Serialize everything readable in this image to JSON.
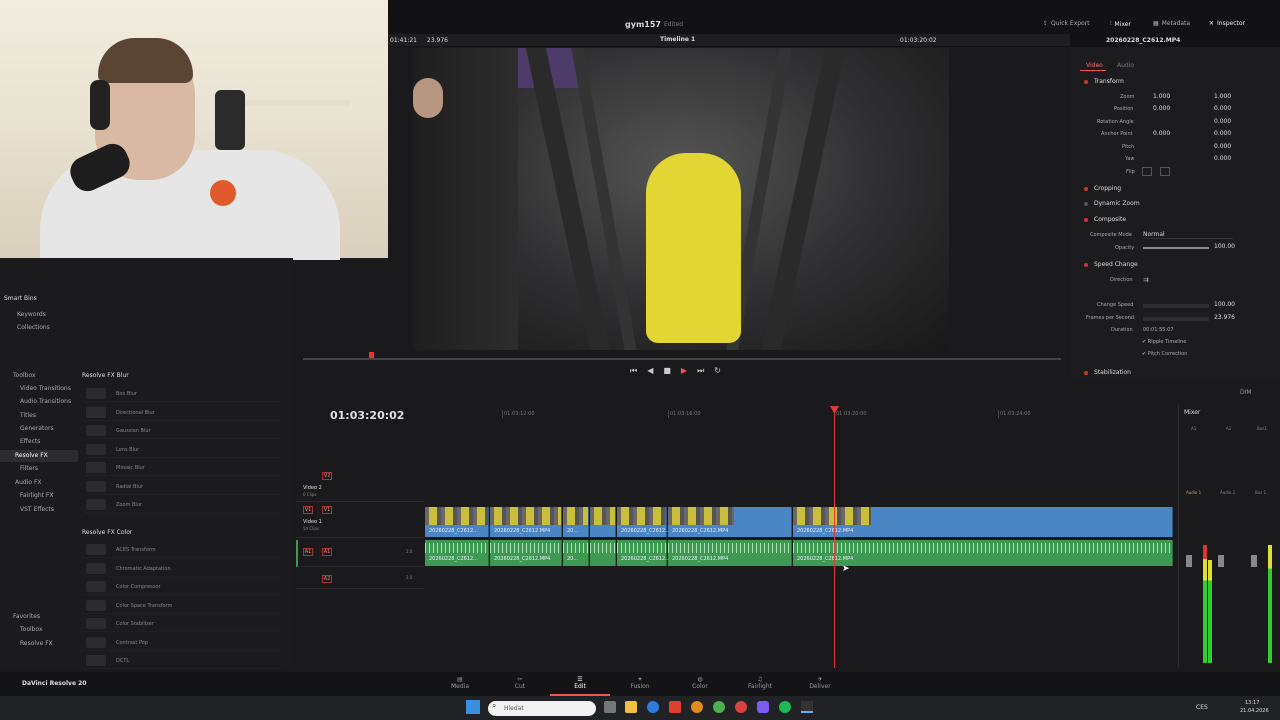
{
  "app": {
    "project": "gym157",
    "edited": "Edited",
    "name": "DaVinci Resolve 20"
  },
  "topbar": {
    "quick_export": "Quick Export",
    "mixer": "Mixer",
    "metadata": "Metadata",
    "inspector": "Inspector"
  },
  "viewer": {
    "tc_left": "01:41:21",
    "fps": "23.976",
    "timeline_name": "Timeline 1",
    "tc_right": "01:03:20:02"
  },
  "inspector": {
    "clip_name": "20260228_C2612.MP4",
    "tabs": [
      "Video",
      "Audio"
    ],
    "transform": "Transform",
    "rows": [
      {
        "label": "Zoom",
        "x": "1.000",
        "y": "1.000"
      },
      {
        "label": "Position",
        "x": "0.000",
        "y": "0.000"
      },
      {
        "label": "Rotation Angle",
        "y": "0.000"
      },
      {
        "label": "Anchor Point",
        "x": "0.000",
        "y": "0.000"
      },
      {
        "label": "Pitch",
        "y": "0.000"
      },
      {
        "label": "Yaw",
        "y": "0.000"
      },
      {
        "label": "Flip"
      }
    ],
    "cropping": "Cropping",
    "dynamic_zoom": "Dynamic Zoom",
    "composite": "Composite",
    "composite_mode_label": "Composite Mode",
    "composite_mode": "Normal",
    "opacity_label": "Opacity",
    "opacity": "100.00",
    "speed_change": "Speed Change",
    "direction": "Direction",
    "change_speed_label": "Change Speed",
    "change_speed": "100.00",
    "fps_label": "Frames per Second",
    "fps": "23.976",
    "duration_label": "Duration",
    "duration": "00:01:55:07",
    "ripple": "Ripple Timeline",
    "pitch_corr": "Pitch Correction",
    "stabilization": "Stabilization"
  },
  "left": {
    "smart_bins": "Smart Bins",
    "keywords": "Keywords",
    "collections": "Collections",
    "toolbox": "Toolbox",
    "tree": [
      "Video Transitions",
      "Audio Transitions",
      "Titles",
      "Generators",
      "Effects",
      "Resolve FX",
      "Filters",
      "Audio FX",
      "Fairlight FX",
      "VST Effects"
    ],
    "favorites": "Favorites",
    "fav_items": [
      "Toolbox",
      "Resolve FX"
    ],
    "blur_header": "Resolve FX Blur",
    "blur": [
      "Box Blur",
      "Directional Blur",
      "Gaussian Blur",
      "Lens Blur",
      "Mosaic Blur",
      "Radial Blur",
      "Zoom Blur"
    ],
    "color_header": "Resolve FX Color",
    "color": [
      "ACES Transform",
      "Chromatic Adaptation",
      "Color Compressor",
      "Color Space Transform",
      "Color Stabilizer",
      "Contrast Pop",
      "DCTL"
    ]
  },
  "timeline": {
    "timecode": "01:03:20:02",
    "ruler": [
      "01:03:12:00",
      "01:03:16:00",
      "01:03:20:00",
      "01:03:24:00"
    ],
    "tracks": {
      "v2": {
        "id": "V2",
        "name": "Video 2",
        "sub": "0 Clips"
      },
      "v1": {
        "id": "V1",
        "name": "Video 1",
        "sub": "54 Clips"
      },
      "a1": {
        "id": "A1",
        "ch": "2.0"
      },
      "a2": {
        "id": "A2",
        "ch": "2.0"
      }
    },
    "clip": "20260228_C2612.MP4",
    "clip_short": "20260228_C2612...",
    "clip_tiny": "20..."
  },
  "mixer": {
    "title": "Mixer",
    "channels": [
      "A1",
      "A2",
      "Bus1"
    ],
    "meters": [
      "Audio 1",
      "Audio 2",
      "Bus 1"
    ],
    "dim": "DIM"
  },
  "pages": [
    "Media",
    "Cut",
    "Edit",
    "Fusion",
    "Color",
    "Fairlight",
    "Deliver"
  ],
  "taskbar": {
    "search": "Hledat",
    "lang": "CES",
    "time": "13:17",
    "date": "21.04.2026"
  }
}
